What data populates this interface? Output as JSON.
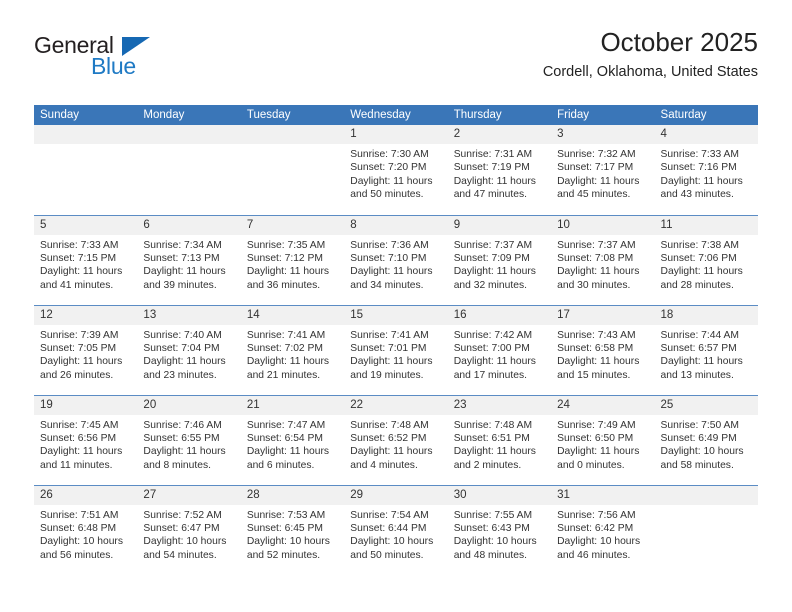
{
  "logo": {
    "word_top": "General",
    "word_bottom": "Blue",
    "triangle_color": "#1668b3",
    "blue_color": "#1f7ac4"
  },
  "header": {
    "title": "October 2025",
    "subtitle": "Cordell, Oklahoma, United States"
  },
  "theme": {
    "header_row_bg": "#3a76b8",
    "daynum_band_bg": "#f1f1f1",
    "week_divider": "#5b8cc4",
    "text": "#333333"
  },
  "weekdays": [
    "Sunday",
    "Monday",
    "Tuesday",
    "Wednesday",
    "Thursday",
    "Friday",
    "Saturday"
  ],
  "weeks": [
    [
      {
        "day": "",
        "empty": true
      },
      {
        "day": "",
        "empty": true
      },
      {
        "day": "",
        "empty": true
      },
      {
        "day": "1",
        "sunrise": "Sunrise: 7:30 AM",
        "sunset": "Sunset: 7:20 PM",
        "daylight_line1": "Daylight: 11 hours",
        "daylight_line2": "and 50 minutes."
      },
      {
        "day": "2",
        "sunrise": "Sunrise: 7:31 AM",
        "sunset": "Sunset: 7:19 PM",
        "daylight_line1": "Daylight: 11 hours",
        "daylight_line2": "and 47 minutes."
      },
      {
        "day": "3",
        "sunrise": "Sunrise: 7:32 AM",
        "sunset": "Sunset: 7:17 PM",
        "daylight_line1": "Daylight: 11 hours",
        "daylight_line2": "and 45 minutes."
      },
      {
        "day": "4",
        "sunrise": "Sunrise: 7:33 AM",
        "sunset": "Sunset: 7:16 PM",
        "daylight_line1": "Daylight: 11 hours",
        "daylight_line2": "and 43 minutes."
      }
    ],
    [
      {
        "day": "5",
        "sunrise": "Sunrise: 7:33 AM",
        "sunset": "Sunset: 7:15 PM",
        "daylight_line1": "Daylight: 11 hours",
        "daylight_line2": "and 41 minutes."
      },
      {
        "day": "6",
        "sunrise": "Sunrise: 7:34 AM",
        "sunset": "Sunset: 7:13 PM",
        "daylight_line1": "Daylight: 11 hours",
        "daylight_line2": "and 39 minutes."
      },
      {
        "day": "7",
        "sunrise": "Sunrise: 7:35 AM",
        "sunset": "Sunset: 7:12 PM",
        "daylight_line1": "Daylight: 11 hours",
        "daylight_line2": "and 36 minutes."
      },
      {
        "day": "8",
        "sunrise": "Sunrise: 7:36 AM",
        "sunset": "Sunset: 7:10 PM",
        "daylight_line1": "Daylight: 11 hours",
        "daylight_line2": "and 34 minutes."
      },
      {
        "day": "9",
        "sunrise": "Sunrise: 7:37 AM",
        "sunset": "Sunset: 7:09 PM",
        "daylight_line1": "Daylight: 11 hours",
        "daylight_line2": "and 32 minutes."
      },
      {
        "day": "10",
        "sunrise": "Sunrise: 7:37 AM",
        "sunset": "Sunset: 7:08 PM",
        "daylight_line1": "Daylight: 11 hours",
        "daylight_line2": "and 30 minutes."
      },
      {
        "day": "11",
        "sunrise": "Sunrise: 7:38 AM",
        "sunset": "Sunset: 7:06 PM",
        "daylight_line1": "Daylight: 11 hours",
        "daylight_line2": "and 28 minutes."
      }
    ],
    [
      {
        "day": "12",
        "sunrise": "Sunrise: 7:39 AM",
        "sunset": "Sunset: 7:05 PM",
        "daylight_line1": "Daylight: 11 hours",
        "daylight_line2": "and 26 minutes."
      },
      {
        "day": "13",
        "sunrise": "Sunrise: 7:40 AM",
        "sunset": "Sunset: 7:04 PM",
        "daylight_line1": "Daylight: 11 hours",
        "daylight_line2": "and 23 minutes."
      },
      {
        "day": "14",
        "sunrise": "Sunrise: 7:41 AM",
        "sunset": "Sunset: 7:02 PM",
        "daylight_line1": "Daylight: 11 hours",
        "daylight_line2": "and 21 minutes."
      },
      {
        "day": "15",
        "sunrise": "Sunrise: 7:41 AM",
        "sunset": "Sunset: 7:01 PM",
        "daylight_line1": "Daylight: 11 hours",
        "daylight_line2": "and 19 minutes."
      },
      {
        "day": "16",
        "sunrise": "Sunrise: 7:42 AM",
        "sunset": "Sunset: 7:00 PM",
        "daylight_line1": "Daylight: 11 hours",
        "daylight_line2": "and 17 minutes."
      },
      {
        "day": "17",
        "sunrise": "Sunrise: 7:43 AM",
        "sunset": "Sunset: 6:58 PM",
        "daylight_line1": "Daylight: 11 hours",
        "daylight_line2": "and 15 minutes."
      },
      {
        "day": "18",
        "sunrise": "Sunrise: 7:44 AM",
        "sunset": "Sunset: 6:57 PM",
        "daylight_line1": "Daylight: 11 hours",
        "daylight_line2": "and 13 minutes."
      }
    ],
    [
      {
        "day": "19",
        "sunrise": "Sunrise: 7:45 AM",
        "sunset": "Sunset: 6:56 PM",
        "daylight_line1": "Daylight: 11 hours",
        "daylight_line2": "and 11 minutes."
      },
      {
        "day": "20",
        "sunrise": "Sunrise: 7:46 AM",
        "sunset": "Sunset: 6:55 PM",
        "daylight_line1": "Daylight: 11 hours",
        "daylight_line2": "and 8 minutes."
      },
      {
        "day": "21",
        "sunrise": "Sunrise: 7:47 AM",
        "sunset": "Sunset: 6:54 PM",
        "daylight_line1": "Daylight: 11 hours",
        "daylight_line2": "and 6 minutes."
      },
      {
        "day": "22",
        "sunrise": "Sunrise: 7:48 AM",
        "sunset": "Sunset: 6:52 PM",
        "daylight_line1": "Daylight: 11 hours",
        "daylight_line2": "and 4 minutes."
      },
      {
        "day": "23",
        "sunrise": "Sunrise: 7:48 AM",
        "sunset": "Sunset: 6:51 PM",
        "daylight_line1": "Daylight: 11 hours",
        "daylight_line2": "and 2 minutes."
      },
      {
        "day": "24",
        "sunrise": "Sunrise: 7:49 AM",
        "sunset": "Sunset: 6:50 PM",
        "daylight_line1": "Daylight: 11 hours",
        "daylight_line2": "and 0 minutes."
      },
      {
        "day": "25",
        "sunrise": "Sunrise: 7:50 AM",
        "sunset": "Sunset: 6:49 PM",
        "daylight_line1": "Daylight: 10 hours",
        "daylight_line2": "and 58 minutes."
      }
    ],
    [
      {
        "day": "26",
        "sunrise": "Sunrise: 7:51 AM",
        "sunset": "Sunset: 6:48 PM",
        "daylight_line1": "Daylight: 10 hours",
        "daylight_line2": "and 56 minutes."
      },
      {
        "day": "27",
        "sunrise": "Sunrise: 7:52 AM",
        "sunset": "Sunset: 6:47 PM",
        "daylight_line1": "Daylight: 10 hours",
        "daylight_line2": "and 54 minutes."
      },
      {
        "day": "28",
        "sunrise": "Sunrise: 7:53 AM",
        "sunset": "Sunset: 6:45 PM",
        "daylight_line1": "Daylight: 10 hours",
        "daylight_line2": "and 52 minutes."
      },
      {
        "day": "29",
        "sunrise": "Sunrise: 7:54 AM",
        "sunset": "Sunset: 6:44 PM",
        "daylight_line1": "Daylight: 10 hours",
        "daylight_line2": "and 50 minutes."
      },
      {
        "day": "30",
        "sunrise": "Sunrise: 7:55 AM",
        "sunset": "Sunset: 6:43 PM",
        "daylight_line1": "Daylight: 10 hours",
        "daylight_line2": "and 48 minutes."
      },
      {
        "day": "31",
        "sunrise": "Sunrise: 7:56 AM",
        "sunset": "Sunset: 6:42 PM",
        "daylight_line1": "Daylight: 10 hours",
        "daylight_line2": "and 46 minutes."
      },
      {
        "day": "",
        "empty": true
      }
    ]
  ]
}
